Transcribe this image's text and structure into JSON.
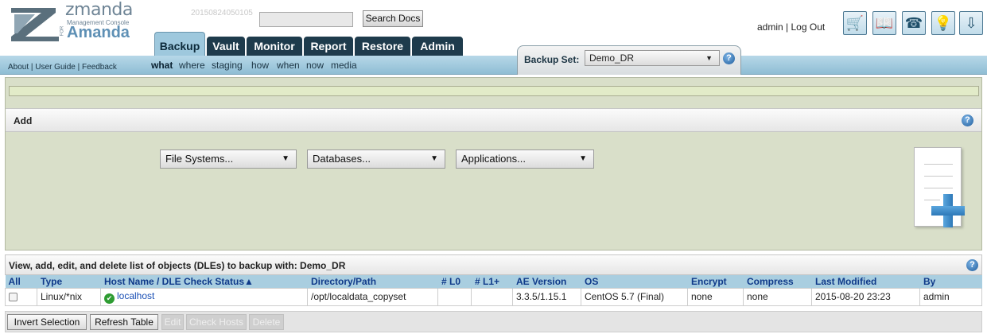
{
  "header": {
    "logo": {
      "brand": "zmanda",
      "subtitle": "Management Console",
      "for": "FOR",
      "product": "Amanda"
    },
    "build_id": "20150824050105",
    "search": {
      "value": "",
      "button_label": "Search Docs"
    },
    "user": {
      "name": "admin",
      "separator": "|",
      "logout_label": "Log Out"
    },
    "tools": [
      {
        "icon": "cart-icon",
        "glyph": "🛒"
      },
      {
        "icon": "book-icon",
        "glyph": "📖"
      },
      {
        "icon": "phone-icon",
        "glyph": "☎"
      },
      {
        "icon": "lightbulb-icon",
        "glyph": "💡"
      },
      {
        "icon": "download-icon",
        "glyph": "⇩"
      }
    ]
  },
  "tabs": [
    {
      "label": "Backup",
      "active": true
    },
    {
      "label": "Vault",
      "active": false
    },
    {
      "label": "Monitor",
      "active": false
    },
    {
      "label": "Report",
      "active": false
    },
    {
      "label": "Restore",
      "active": false
    },
    {
      "label": "Admin",
      "active": false
    }
  ],
  "nav": {
    "about_links": "About | User Guide | Feedback",
    "subtabs": [
      {
        "label": "what",
        "active": true
      },
      {
        "label": "where",
        "active": false
      },
      {
        "label": "staging",
        "active": false
      },
      {
        "label": "how",
        "active": false
      },
      {
        "label": "when",
        "active": false
      },
      {
        "label": "now",
        "active": false
      },
      {
        "label": "media",
        "active": false
      }
    ]
  },
  "backup_set": {
    "label": "Backup Set:",
    "value": "Demo_DR",
    "help": "?"
  },
  "add_panel": {
    "title": "Add",
    "help": "?",
    "dropdowns": [
      {
        "name": "file-systems-select",
        "value": "File Systems..."
      },
      {
        "name": "databases-select",
        "value": "Databases..."
      },
      {
        "name": "applications-select",
        "value": "Applications..."
      }
    ]
  },
  "list": {
    "title": "View, add, edit, and delete list of objects (DLEs) to backup with: Demo_DR",
    "help": "?",
    "columns": [
      "All",
      "Type",
      "Host Name / DLE Check Status▲",
      "Directory/Path",
      "# L0",
      "# L1+",
      "AE Version",
      "OS",
      "Encrypt",
      "Compress",
      "Last Modified",
      "By"
    ],
    "rows": [
      {
        "type": "Linux/*nix",
        "host": "localhost",
        "path": "/opt/localdata_copyset",
        "l0": "",
        "l1": "",
        "ae_version": "3.3.5/1.15.1",
        "os": "CentOS 5.7 (Final)",
        "encrypt": "none",
        "compress": "none",
        "last_modified": "2015-08-20 23:23",
        "by": "admin"
      }
    ]
  },
  "footer": {
    "buttons": [
      {
        "label": "Invert Selection",
        "enabled": true
      },
      {
        "label": "Refresh Table",
        "enabled": true
      },
      {
        "label": "Edit",
        "enabled": false
      },
      {
        "label": "Check Hosts",
        "enabled": false
      },
      {
        "label": "Delete",
        "enabled": false
      }
    ]
  },
  "colors": {
    "accent": "#9ec8dd",
    "tab_dark": "#1e3b4c",
    "panel_bg": "#d9dfc9",
    "link": "#1a4fb5",
    "header_text": "#0f3a8a"
  }
}
